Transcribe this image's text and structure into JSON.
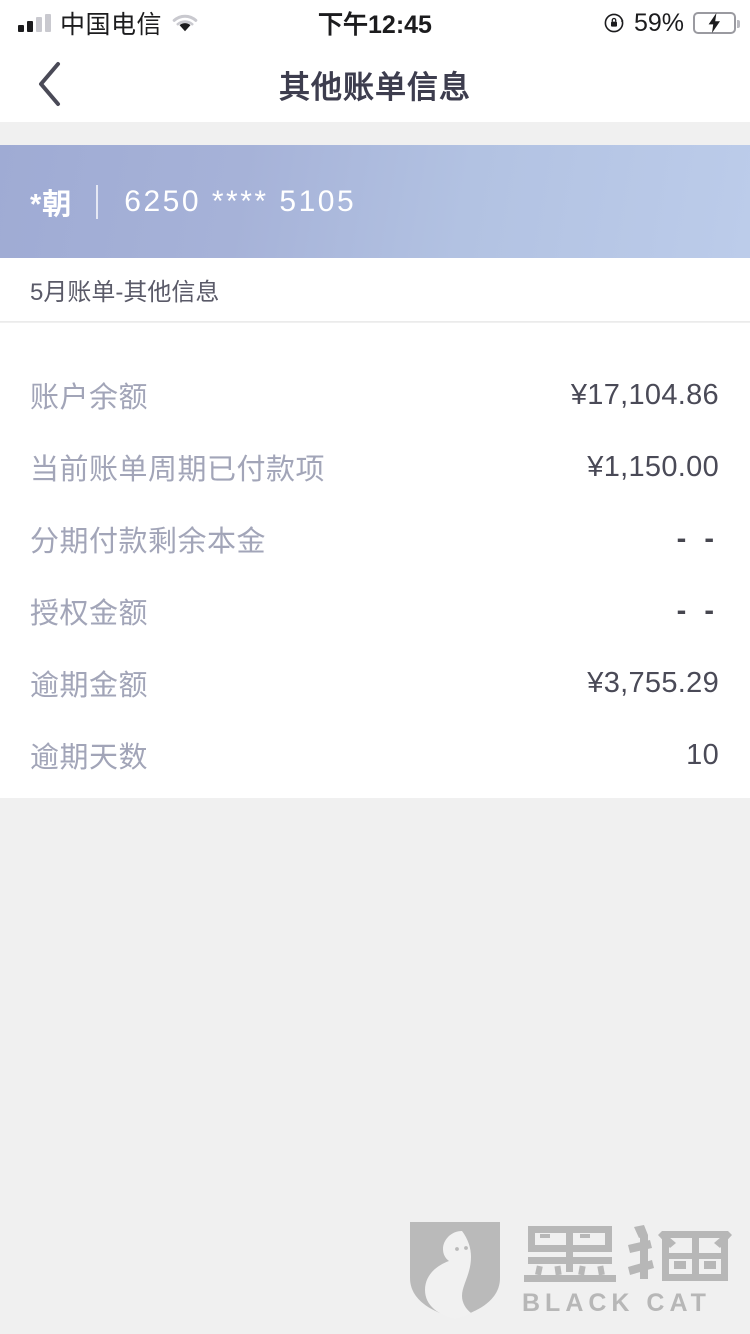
{
  "statusbar": {
    "carrier": "中国电信",
    "time": "下午12:45",
    "battery_percent": "59%",
    "signal_icon": "cellular-signal-icon",
    "wifi_icon": "wifi-icon",
    "rotation_lock_icon": "rotation-lock-icon",
    "battery_icon": "battery-charging-icon"
  },
  "navbar": {
    "back_icon": "back-chevron-icon",
    "title": "其他账单信息"
  },
  "card": {
    "holder": "*朝",
    "number": "6250 **** 5105",
    "gradient_start": "#9fabd4",
    "gradient_end": "#bcccea"
  },
  "section": {
    "subtitle": "5月账单-其他信息"
  },
  "details": {
    "rows": [
      {
        "label": "账户余额",
        "value": "¥17,104.86"
      },
      {
        "label": "当前账单周期已付款项",
        "value": "¥1,150.00"
      },
      {
        "label": "分期付款剩余本金",
        "value": "- -"
      },
      {
        "label": "授权金额",
        "value": "- -"
      },
      {
        "label": "逾期金额",
        "value": "¥3,755.29"
      },
      {
        "label": "逾期天数",
        "value": "10"
      }
    ]
  },
  "watermark": {
    "logo_icon": "black-cat-shield-logo-icon",
    "name_cn": "黑猫",
    "name_en": "BLACK CAT"
  },
  "colors": {
    "page_background": "#f0f0f0",
    "content_background": "#ffffff",
    "label_text": "#a2a5b8",
    "value_text": "#4a4a57",
    "title_text": "#3d3d4e",
    "battery_green": "#2ccf55"
  }
}
